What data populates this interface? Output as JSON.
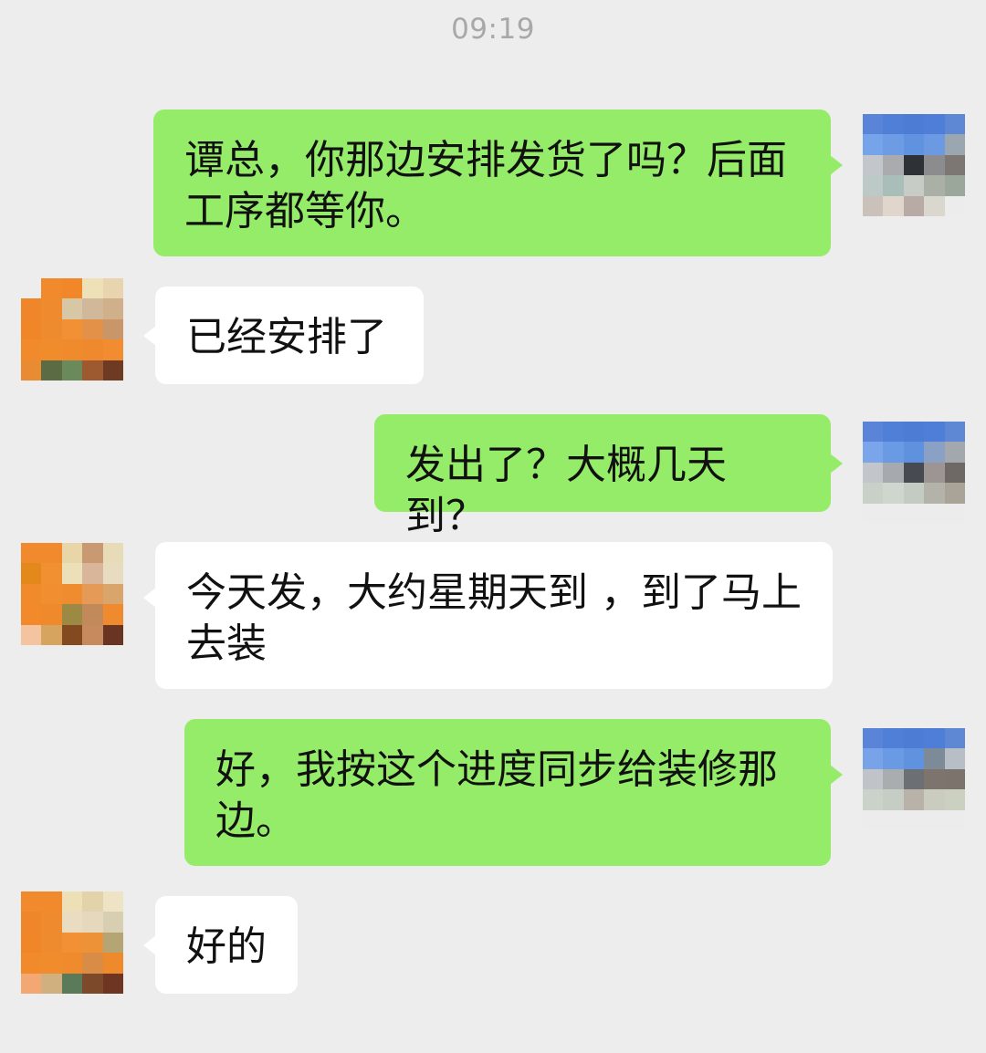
{
  "timestamp": "09:19",
  "messages": [
    {
      "side": "sent",
      "text": "谭总，你那边安排发货了吗？后面工序都等你。"
    },
    {
      "side": "recv",
      "text": "已经安排了"
    },
    {
      "side": "sent",
      "text": "发出了？大概几天到？"
    },
    {
      "side": "recv",
      "text": "今天发，大约星期天到 ，到了马上去装"
    },
    {
      "side": "sent",
      "text": "好，我按这个进度同步给装修那边。"
    },
    {
      "side": "recv",
      "text": "好的"
    }
  ],
  "colors": {
    "background": "#ededed",
    "sent_bubble": "#95ec69",
    "received_bubble": "#ffffff",
    "timestamp_text": "#a8a8a8"
  }
}
